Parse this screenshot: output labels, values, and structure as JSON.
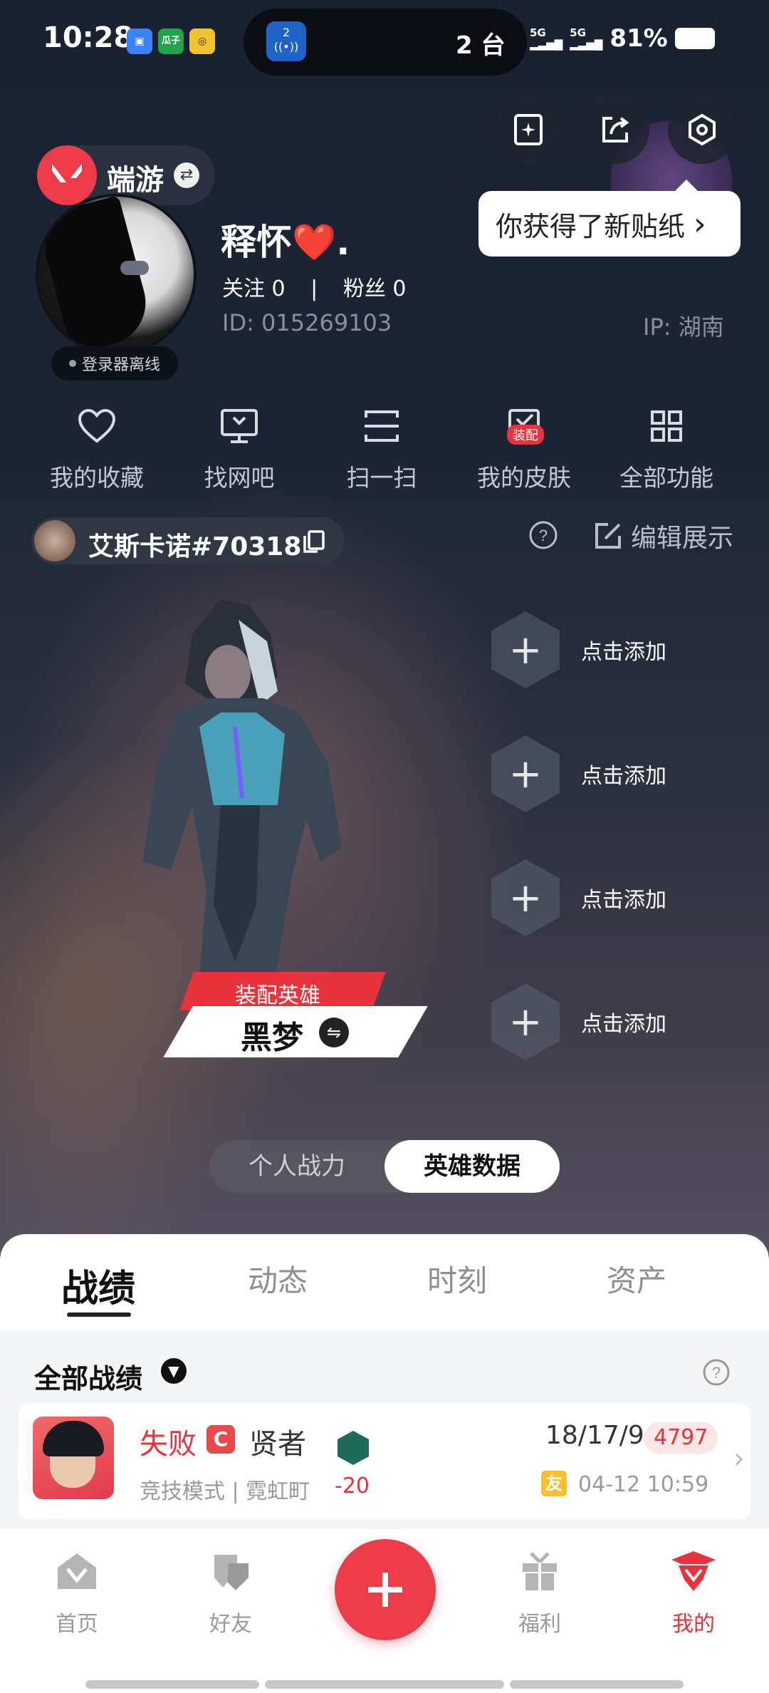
{
  "status": {
    "time": "10:28",
    "apps": [
      "",
      "瓜子",
      ""
    ],
    "island_badge": "2",
    "island_text": "2 台",
    "signal1": "5G",
    "signal2": "5G",
    "battery": "81%"
  },
  "profile": {
    "game_name": "端游",
    "offline_label": "登录器离线",
    "nickname": "释怀❤️.",
    "follow": "关注 0",
    "fans": "粉丝 0",
    "follow_sep": "|",
    "uid": "ID:  015269103",
    "ip": "IP:  湖南"
  },
  "tooltip": {
    "text": "你获得了新贴纸",
    "chevron": "›"
  },
  "quick_actions": [
    {
      "label": "我的收藏",
      "icon": "heart-icon"
    },
    {
      "label": "找网吧",
      "icon": "monitor-icon"
    },
    {
      "label": "扫一扫",
      "icon": "scan-icon"
    },
    {
      "label": "我的皮肤",
      "icon": "skin-icon",
      "badge": "装配"
    },
    {
      "label": "全部功能",
      "icon": "grid-icon"
    }
  ],
  "account": {
    "name": "艾斯卡诺#70318",
    "edit_label": "编辑展示"
  },
  "hero": {
    "tag": "装配英雄",
    "name": "黑梦"
  },
  "add_slots": [
    "点击添加",
    "点击添加",
    "点击添加",
    "点击添加"
  ],
  "toggle": {
    "left": "个人战力",
    "right": "英雄数据"
  },
  "tabs": [
    "战绩",
    "动态",
    "时刻",
    "资产"
  ],
  "filter": {
    "label": "全部战绩"
  },
  "match": {
    "result": "失败",
    "rank_letter": "C",
    "rank_name": "贤者",
    "mode": "竞技模式 | 霓虹町",
    "delta": "-20",
    "kda": "18/17/9",
    "score": "4797",
    "friend_tag": "友",
    "time": "04-12 10:59"
  },
  "bottom_nav": [
    {
      "label": "首页",
      "icon": "home-icon"
    },
    {
      "label": "好友",
      "icon": "friends-icon"
    },
    {
      "label": "福利",
      "icon": "gift-icon"
    },
    {
      "label": "我的",
      "icon": "profile-icon",
      "active": true
    }
  ],
  "colors": {
    "accent": "#ee3b4a",
    "background": "#1b2230"
  }
}
